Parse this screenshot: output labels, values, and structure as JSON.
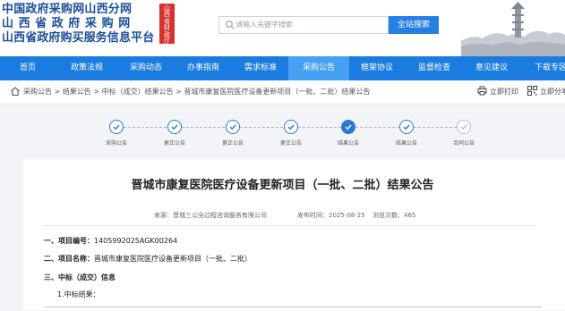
{
  "header": {
    "logo_lines": [
      "中国政府采购网山西分网",
      "山西省政府采购网",
      "山西省政府购买服务信息平台"
    ],
    "seal_text": "山西省财政厅",
    "search_placeholder": "请输入关键字搜索",
    "search_button": "全站搜索"
  },
  "nav": {
    "items": [
      "首页",
      "政策法规",
      "采购动态",
      "办事指南",
      "需求标准",
      "采购公告",
      "框架协议",
      "监督检查",
      "意见建议",
      "下载专区"
    ],
    "active_index": 5
  },
  "breadcrumb": {
    "path": "采购公告 > 结果公告 > 中标（成交）结果公告 > 晋城市康复医院医疗设备更新项目（一批、二批）结果公告",
    "print_label": "立即打印",
    "share_label": "立即分享"
  },
  "progress": {
    "steps": [
      {
        "label": "采购公告",
        "state": "done"
      },
      {
        "label": "更正公告",
        "state": "done"
      },
      {
        "label": "更正公告",
        "state": "done"
      },
      {
        "label": "更正公告",
        "state": "done"
      },
      {
        "label": "结果公告",
        "state": "current"
      },
      {
        "label": "结果公告",
        "state": "done"
      },
      {
        "label": "合同公告",
        "state": "pending"
      }
    ]
  },
  "article": {
    "title": "晋城市康复医院医疗设备更新项目（一批、二批）结果公告",
    "source": "来源：晋城三公全过程咨询服务有限公司",
    "publish_time": "发布时间：2025-08-25",
    "views": "浏览次数：465",
    "item1_label": "一、项目编号：",
    "item1_value": "1405992025AGK00264",
    "item2_label": "二、项目名称：",
    "item2_value": "晋城市康复医院医疗设备更新项目（一批、二批）",
    "item3_label": "三、中标（成交）信息",
    "sub1": "1.中标结果："
  },
  "colors": {
    "primary": "#1a7ce0",
    "nav_active": "#46a0f4",
    "logo_text": "#1b4f9c",
    "seal": "#d7322e"
  },
  "icons": [
    "search-icon",
    "home-icon",
    "print-icon",
    "qrcode-icon",
    "check-icon"
  ]
}
